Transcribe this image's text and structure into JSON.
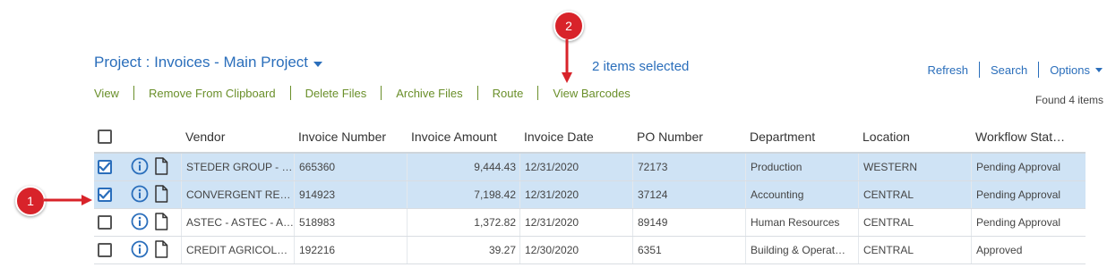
{
  "header": {
    "title": "Project : Invoices - Main Project",
    "selected_count": "2 items selected",
    "refresh": "Refresh",
    "search": "Search",
    "options": "Options",
    "found": "Found 4 items"
  },
  "toolbar": {
    "view": "View",
    "remove_clipboard": "Remove From Clipboard",
    "delete_files": "Delete Files",
    "archive_files": "Archive Files",
    "route": "Route",
    "view_barcodes": "View Barcodes"
  },
  "columns": [
    "Vendor",
    "Invoice Number",
    "Invoice Amount",
    "Invoice Date",
    "PO Number",
    "Department",
    "Location",
    "Workflow Stat…"
  ],
  "rows": [
    {
      "checked": true,
      "vendor": "STEDER GROUP - …",
      "invoice_number": "665360",
      "invoice_amount": "9,444.43",
      "invoice_date": "12/31/2020",
      "po_number": "72173",
      "department": "Production",
      "location": "WESTERN",
      "workflow": "Pending Approval"
    },
    {
      "checked": true,
      "vendor": "CONVERGENT RE…",
      "invoice_number": "914923",
      "invoice_amount": "7,198.42",
      "invoice_date": "12/31/2020",
      "po_number": "37124",
      "department": "Accounting",
      "location": "CENTRAL",
      "workflow": "Pending Approval"
    },
    {
      "checked": false,
      "vendor": "ASTEC - ASTEC - A…",
      "invoice_number": "518983",
      "invoice_amount": "1,372.82",
      "invoice_date": "12/31/2020",
      "po_number": "89149",
      "department": "Human Resources",
      "location": "CENTRAL",
      "workflow": "Pending Approval"
    },
    {
      "checked": false,
      "vendor": "CREDIT AGRICOL…",
      "invoice_number": "192216",
      "invoice_amount": "39.27",
      "invoice_date": "12/30/2020",
      "po_number": "6351",
      "department": "Building & Operat…",
      "location": "CENTRAL",
      "workflow": "Approved"
    }
  ],
  "annotations": {
    "one": "1",
    "two": "2"
  },
  "colors": {
    "accent": "#2a6ebb",
    "toolbar": "#6a8f2a",
    "selected_row": "#cfe3f5",
    "badge": "#d8232a"
  },
  "icons": [
    "chevron-down-icon",
    "info-icon",
    "document-icon",
    "checkbox-icon",
    "arrow-icon"
  ]
}
